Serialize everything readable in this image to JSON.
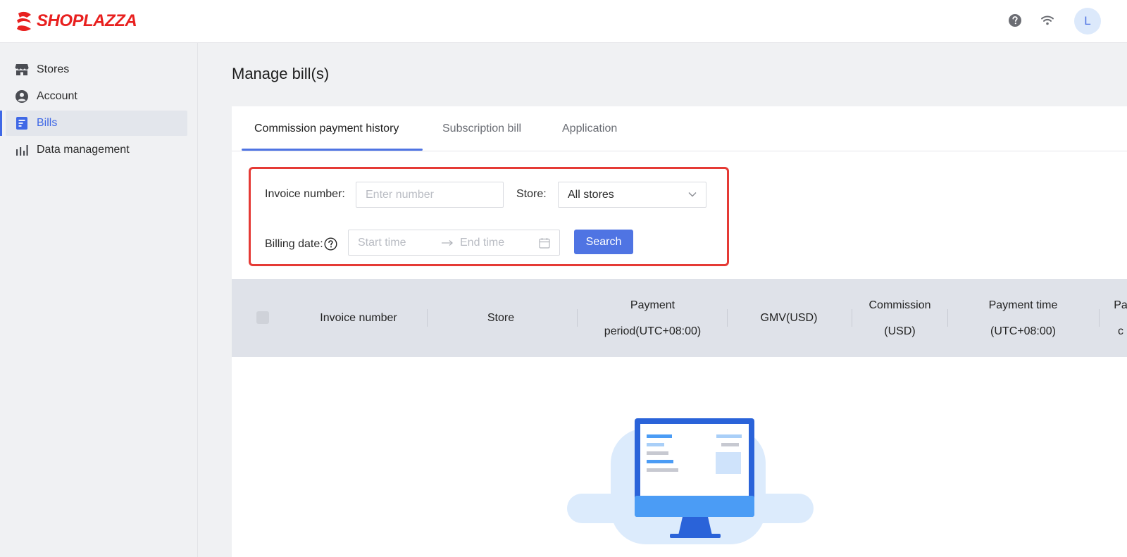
{
  "brand": {
    "name": "SHOPLAZZA",
    "color": "#e8201f"
  },
  "header": {
    "help_icon": "question-circle-icon",
    "network_icon": "wifi-icon",
    "avatar_initial": "L"
  },
  "sidebar": {
    "items": [
      {
        "label": "Stores",
        "icon": "store-icon"
      },
      {
        "label": "Account",
        "icon": "user-circle-icon"
      },
      {
        "label": "Bills",
        "icon": "bill-icon",
        "active": true
      },
      {
        "label": "Data management",
        "icon": "bar-chart-icon"
      }
    ]
  },
  "page": {
    "title": "Manage bill(s)"
  },
  "tabs": [
    {
      "label": "Commission payment history",
      "active": true
    },
    {
      "label": "Subscription bill"
    },
    {
      "label": "Application"
    }
  ],
  "filters": {
    "invoice_label": "Invoice number:",
    "invoice_placeholder": "Enter number",
    "store_label": "Store:",
    "store_value": "All stores",
    "billing_label": "Billing date:",
    "start_placeholder": "Start time",
    "end_placeholder": "End time",
    "search_label": "Search"
  },
  "table": {
    "columns": [
      {
        "line1": "Invoice number",
        "line2": ""
      },
      {
        "line1": "Store",
        "line2": ""
      },
      {
        "line1": "Payment",
        "line2": "period(UTC+08:00)"
      },
      {
        "line1": "GMV(USD)",
        "line2": ""
      },
      {
        "line1": "Commission",
        "line2": "(USD)"
      },
      {
        "line1": "Payment time",
        "line2": "(UTC+08:00)"
      },
      {
        "line1": "Pa",
        "line2": "c"
      }
    ]
  },
  "colors": {
    "accent": "#4f74e3",
    "highlight_border": "#e53a35"
  }
}
